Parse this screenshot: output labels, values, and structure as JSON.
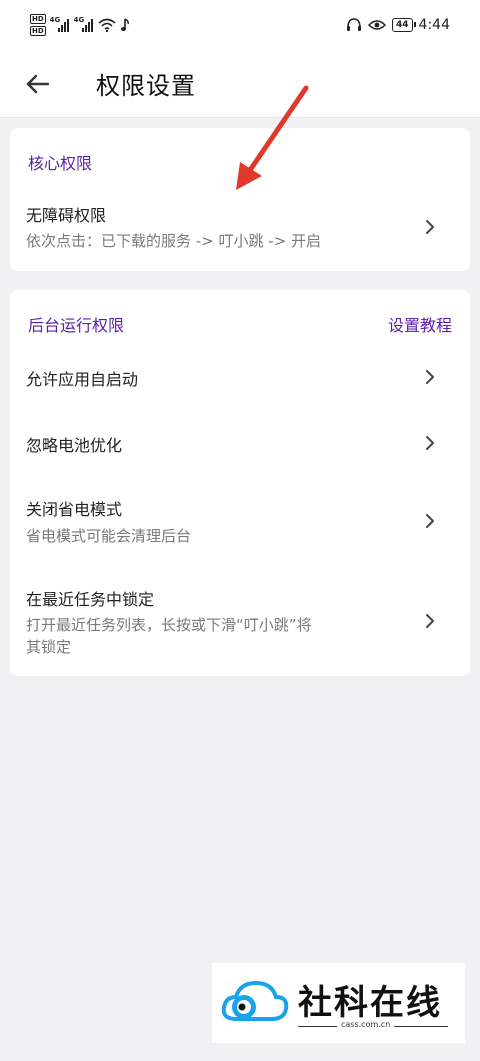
{
  "status_bar": {
    "hd1": "HD",
    "hd2": "HD",
    "net1": "4G",
    "net2": "4G",
    "battery": "44",
    "time": "4:44",
    "icons": [
      "wifi-icon",
      "music-icon",
      "headphones-icon",
      "eye-icon"
    ]
  },
  "header": {
    "back_icon": "arrow-left-icon",
    "title": "权限设置"
  },
  "core_section": {
    "title": "核心权限",
    "items": [
      {
        "title": "无障碍权限",
        "desc": "依次点击：已下载的服务 -> 叮小跳 -> 开启"
      }
    ]
  },
  "background_section": {
    "title": "后台运行权限",
    "tutorial_link": "设置教程",
    "items": [
      {
        "title": "允许应用自启动"
      },
      {
        "title": "忽略电池优化"
      },
      {
        "title": "关闭省电模式",
        "desc": "省电模式可能会清理后台"
      },
      {
        "title": "在最近任务中锁定",
        "desc_line1": "打开最近任务列表，长按或下滑“叮小跳”将",
        "desc_line2": "其锁定"
      }
    ]
  },
  "annotation": {
    "arrow_color": "#e0392b"
  },
  "watermark": {
    "text": "社科在线",
    "url": "cass.com.cn"
  },
  "colors": {
    "accent": "#5b1fa6",
    "background": "#f1f1f3"
  }
}
